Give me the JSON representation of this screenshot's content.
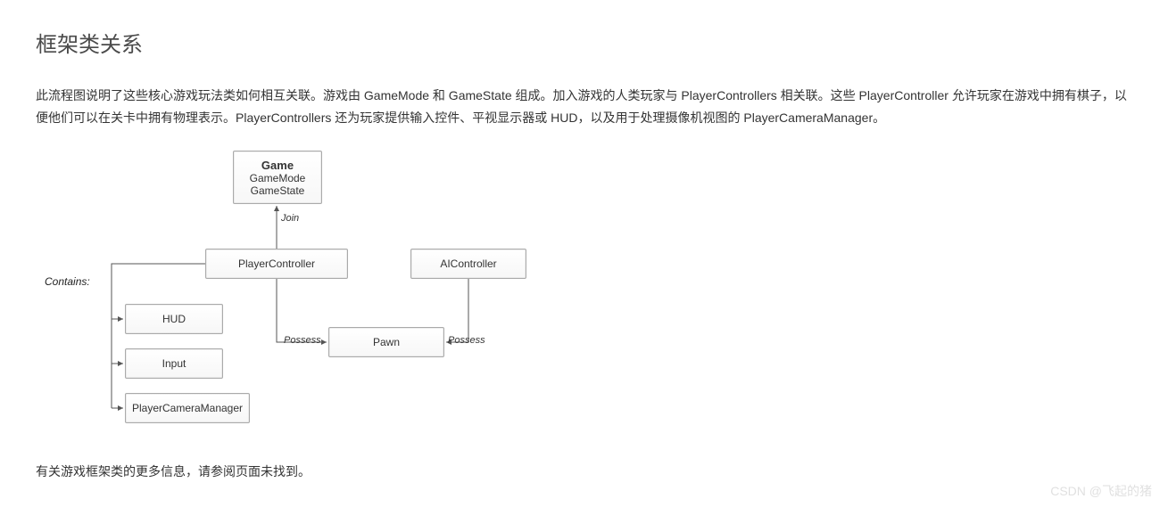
{
  "heading": "框架类关系",
  "paragraph": "此流程图说明了这些核心游戏玩法类如何相互关联。游戏由 GameMode 和 GameState 组成。加入游戏的人类玩家与 PlayerControllers 相关联。这些 PlayerController 允许玩家在游戏中拥有棋子，以便他们可以在关卡中拥有物理表示。PlayerControllers 还为玩家提供输入控件、平视显示器或 HUD，以及用于处理摄像机视图的 PlayerCameraManager。",
  "diagram": {
    "game": {
      "title": "Game",
      "mode": "GameMode",
      "state": "GameState"
    },
    "playerController": "PlayerController",
    "aiController": "AIController",
    "pawn": "Pawn",
    "hud": "HUD",
    "input": "Input",
    "playerCameraManager": "PlayerCameraManager",
    "labels": {
      "contains": "Contains:",
      "join": "Join",
      "possessLeft": "Possess",
      "possessRight": "Possess"
    }
  },
  "footer": "有关游戏框架类的更多信息，请参阅页面未找到。",
  "watermark": "CSDN @飞起的猪"
}
